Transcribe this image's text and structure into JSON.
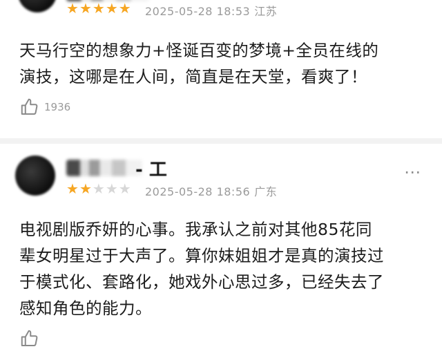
{
  "reviews": [
    {
      "stars_filled": 5,
      "stars_total": 5,
      "date": "2025-05-28 18:53",
      "location": "江苏",
      "text_lines": [
        "天马行空的想象力+怪诞百变的梦境+全员在线的",
        "演技，这哪是在人间，简直是在天堂，看爽了！"
      ],
      "likes": "1936"
    },
    {
      "name_tail": "- 工",
      "stars_filled": 2,
      "stars_total": 5,
      "date": "2025-05-28 18:56",
      "location": "广东",
      "text_lines": [
        "电视剧版乔妍的心事。我承认之前对其他85花同",
        "辈女明星过于大声了。算你妹姐姐才是真的演技过",
        "于模式化、套路化，她戏外心思过多，已经失去了",
        "感知角色的能力。"
      ],
      "more": "⋯"
    }
  ],
  "colors": {
    "star_on": "#f6a623",
    "star_off": "#d7d7d7",
    "meta": "#9a9a9a"
  }
}
